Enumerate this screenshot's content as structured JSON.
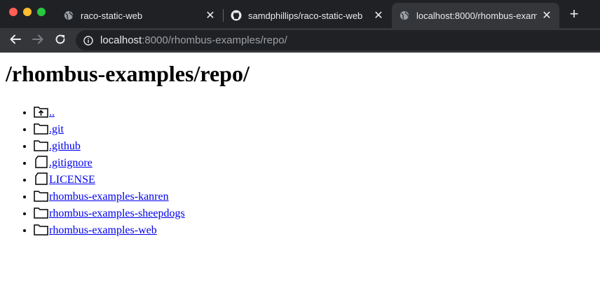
{
  "browser": {
    "tabs": [
      {
        "title": "raco-static-web",
        "icon": "globe-icon",
        "active": false
      },
      {
        "title": "samdphillips/raco-static-web",
        "icon": "github-icon",
        "active": false
      },
      {
        "title": "localhost:8000/rhombus-exam",
        "icon": "globe-icon",
        "active": true
      }
    ],
    "address": {
      "host": "localhost",
      "rest": ":8000/rhombus-examples/repo/"
    }
  },
  "page": {
    "heading": "/rhombus-examples/repo/",
    "entries": [
      {
        "label": "..",
        "kind": "parent-folder-icon"
      },
      {
        "label": ".git",
        "kind": "folder-icon"
      },
      {
        "label": ".github",
        "kind": "folder-icon"
      },
      {
        "label": ".gitignore",
        "kind": "file-icon"
      },
      {
        "label": "LICENSE",
        "kind": "file-icon"
      },
      {
        "label": "rhombus-examples-kanren",
        "kind": "folder-icon"
      },
      {
        "label": "rhombus-examples-sheepdogs",
        "kind": "folder-icon"
      },
      {
        "label": "rhombus-examples-web",
        "kind": "folder-icon"
      }
    ]
  },
  "colors": {
    "chrome_dark": "#202124",
    "chrome_tab": "#35363a",
    "link": "#0000ee"
  }
}
